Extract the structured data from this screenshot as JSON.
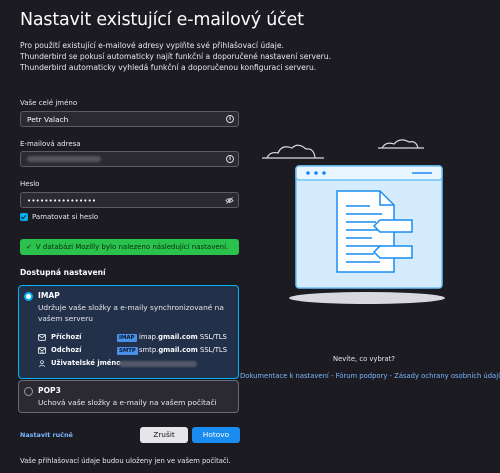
{
  "page": {
    "title": "Nastavit existující e-mailový účet",
    "intro": [
      "Pro použití existující e-mailové adresy vyplňte své přihlašovací údaje.",
      "Thunderbird se pokusí automaticky najít funkční a doporučené nastavení serveru.",
      "Thunderbird automaticky vyhledá funkční a doporučenou konfiguraci serveru."
    ]
  },
  "form": {
    "name_label": "Vaše celé jméno",
    "name_value": "Petr Valach",
    "email_label": "E-mailová adresa",
    "password_label": "Heslo",
    "password_value": "••••••••••••••••",
    "remember_label": "Pamatovat si heslo"
  },
  "success_message": "V databázi Mozilly bylo nalezeno následující nastavení.",
  "configs": {
    "title": "Dostupná nastavení",
    "imap": {
      "name": "IMAP",
      "description_1": "Udržuje vaše složky a e-maily synchronizované na",
      "description_2": "vašem serveru",
      "incoming_label": "Příchozí",
      "incoming_tag": "IMAP",
      "incoming_host_prefix": "imap.",
      "incoming_host_domain": "gmail.com",
      "incoming_security": "SSL/TLS",
      "outgoing_label": "Odchozí",
      "outgoing_tag": "SMTP",
      "outgoing_host_prefix": "smtp.",
      "outgoing_host_domain": "gmail.com",
      "outgoing_security": "SSL/TLS",
      "username_label": "Uživatelské jméno"
    },
    "pop3": {
      "name": "POP3",
      "description": "Uchová vaše složky a e-maily na vašem počítači"
    }
  },
  "actions": {
    "manual": "Nastavit ručně",
    "cancel": "Zrušit",
    "done": "Hotovo"
  },
  "footnote": "Vaše přihlašovací údaje budou uloženy jen ve vašem počítači.",
  "help": {
    "question": "Nevíte, co vybrat?",
    "link_docs": "Dokumentace k nastavení",
    "link_forum": "Fórum podpory",
    "link_privacy": "Zásady ochrany osobních údajů",
    "separator": " - "
  },
  "colors": {
    "background": "#1c1b22",
    "accent": "#00b3f4",
    "success": "#2ac14c",
    "primary_button": "#1a8cf0",
    "link": "#7ab8ff"
  }
}
